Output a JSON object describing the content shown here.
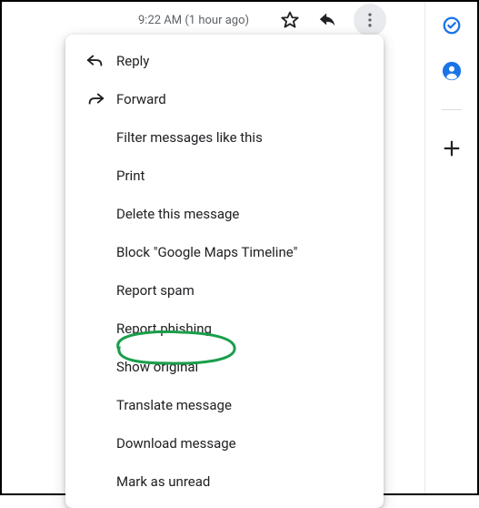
{
  "header": {
    "timestamp": "9:22 AM (1 hour ago)"
  },
  "menu": {
    "items": [
      {
        "label": "Reply",
        "icon": "reply-icon"
      },
      {
        "label": "Forward",
        "icon": "forward-icon"
      },
      {
        "label": "Filter messages like this"
      },
      {
        "label": "Print"
      },
      {
        "label": "Delete this message"
      },
      {
        "label": "Block \"Google Maps Timeline\""
      },
      {
        "label": "Report spam"
      },
      {
        "label": "Report phishing"
      },
      {
        "label": "Show original"
      },
      {
        "label": "Translate message"
      },
      {
        "label": "Download message"
      },
      {
        "label": "Mark as unread"
      }
    ]
  },
  "annotation": {
    "target_label": "Show original",
    "color": "#1a9e4b"
  }
}
